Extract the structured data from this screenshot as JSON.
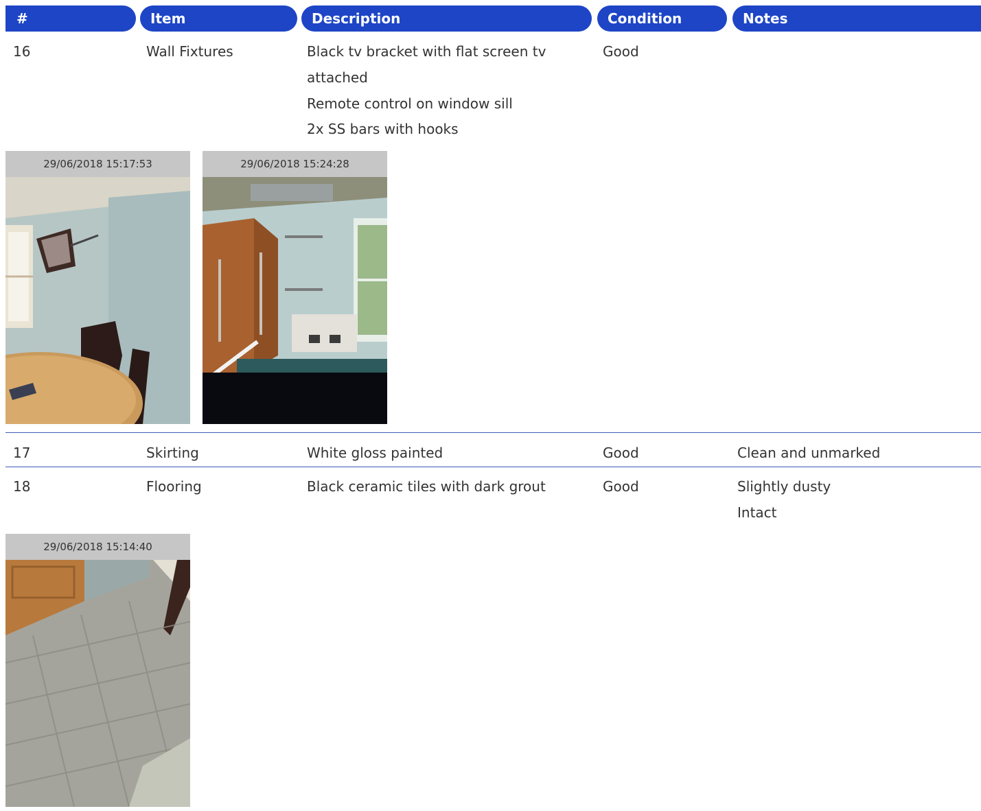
{
  "headers": [
    "#",
    "Item",
    "Description",
    "Condition",
    "Notes"
  ],
  "rows": [
    {
      "num": "16",
      "item": "Wall Fixtures",
      "description": [
        "Black tv bracket with flat screen tv",
        "attached",
        "Remote control on window sill",
        "2x SS bars with hooks"
      ],
      "condition": "Good",
      "notes": [],
      "photos": [
        {
          "timestamp": "29/06/2018 15:17:53"
        },
        {
          "timestamp": "29/06/2018 15:24:28"
        }
      ]
    },
    {
      "num": "17",
      "item": "Skirting",
      "description": [
        "White gloss painted"
      ],
      "condition": "Good",
      "notes": [
        "Clean and unmarked"
      ],
      "photos": []
    },
    {
      "num": "18",
      "item": "Flooring",
      "description": [
        "Black ceramic tiles with dark grout"
      ],
      "condition": "Good",
      "notes": [
        "Slightly dusty",
        "Intact"
      ],
      "photos": [
        {
          "timestamp": "29/06/2018 15:14:40"
        }
      ]
    }
  ],
  "colors": {
    "header_bg": "#1d45c6",
    "rule": "#3f5fb7",
    "stamp_bg": "#c6c6c6"
  }
}
